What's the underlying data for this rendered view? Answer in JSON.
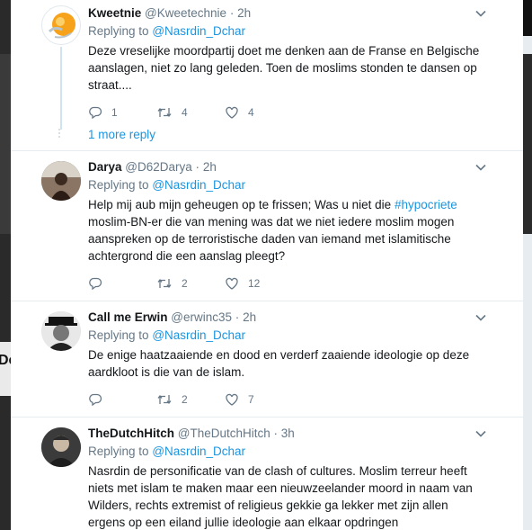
{
  "tweets": [
    {
      "name": "Kweetnie",
      "handle": "@Kweetechnie",
      "time": "2h",
      "replying_prefix": "Replying to",
      "replying_to": "@Nasrdin_Dchar",
      "text": "Deze vreselijke moordpartij doet me denken aan de Franse en Belgische aanslagen, niet zo lang geleden. Toen de moslims stonden te dansen op straat....",
      "replies": "1",
      "retweets": "4",
      "likes": "4"
    },
    {
      "name": "Darya",
      "handle": "@D62Darya",
      "time": "2h",
      "replying_prefix": "Replying to",
      "replying_to": "@Nasrdin_Dchar",
      "text_before": "Help mij aub mijn geheugen op te frissen; Was u niet die ",
      "hashtag": "#hypocriete",
      "text_after": " moslim-BN-er die van mening was dat we niet iedere moslim mogen aanspreken op de terroristische daden van iemand met islamitische achtergrond die een aanslag pleegt?",
      "replies": "",
      "retweets": "2",
      "likes": "12"
    },
    {
      "name": "Call me Erwin",
      "handle": "@erwinc35",
      "time": "2h",
      "replying_prefix": "Replying to",
      "replying_to": "@Nasrdin_Dchar",
      "text": "De enige haatzaaiende en dood en verderf zaaiende ideologie op deze aardkloot is die van de islam.",
      "replies": "",
      "retweets": "2",
      "likes": "7"
    },
    {
      "name": "TheDutchHitch",
      "handle": "@TheDutchHitch",
      "time": "3h",
      "replying_prefix": "Replying to",
      "replying_to": "@Nasrdin_Dchar",
      "text": "Nasrdin de personificatie van de clash of cultures. Moslim terreur heeft niets met islam te maken maar een nieuwzeelander moord in naam van Wilders, rechts extremist of religieus gekkie ga lekker met zijn allen ergens op een eiland jullie ideologie aan elkaar opdringen"
    }
  ],
  "more_replies": "1 more reply",
  "dot": "·",
  "background_cutoff": "De",
  "colors": {
    "link": "#1b95e0",
    "muted": "#657786",
    "text": "#14171a",
    "divider": "#e6ecf0"
  },
  "icons": [
    "reply-icon",
    "retweet-icon",
    "like-icon",
    "chevron-down-icon"
  ]
}
